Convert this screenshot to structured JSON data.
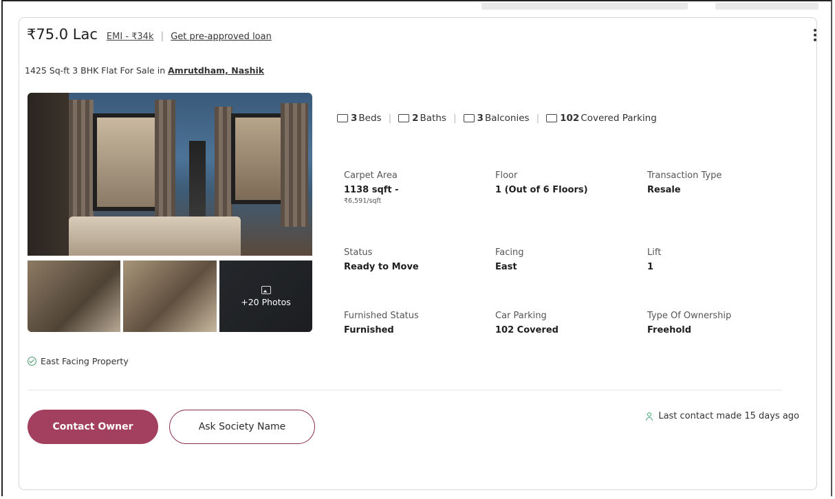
{
  "listing": {
    "price": "₹75.0 Lac",
    "emi": "EMI - ₹34k",
    "separator": "|",
    "loan_link": "Get pre-approved loan",
    "subtitle": "1425 Sq-ft 3 BHK Flat For Sale in",
    "location": "Amrutdham, Nashik"
  },
  "photos": {
    "more_label": "+20 Photos"
  },
  "amenities": [
    {
      "count": "3",
      "label": "Beds",
      "icon": "bed-icon"
    },
    {
      "count": "2",
      "label": "Baths",
      "icon": "bath-icon"
    },
    {
      "count": "3",
      "label": "Balconies",
      "icon": "balcony-icon"
    },
    {
      "count": "102",
      "label": "Covered Parking",
      "icon": "car-icon"
    }
  ],
  "specs": {
    "carpet": {
      "label": "Carpet Area",
      "value": "1138 sqft -",
      "sub": "₹6,591/sqft"
    },
    "floor": {
      "label": "Floor",
      "value": "1 (Out of 6 Floors)"
    },
    "transaction": {
      "label": "Transaction Type",
      "value": "Resale"
    },
    "status": {
      "label": "Status",
      "value": "Ready to Move"
    },
    "facing": {
      "label": "Facing",
      "value": "East"
    },
    "lift": {
      "label": "Lift",
      "value": "1"
    },
    "furnished": {
      "label": "Furnished Status",
      "value": "Furnished"
    },
    "car_parking": {
      "label": "Car Parking",
      "value": "102 Covered"
    },
    "ownership": {
      "label": "Type Of Ownership",
      "value": "Freehold"
    }
  },
  "highlight": "East Facing Property",
  "actions": {
    "contact": "Contact Owner",
    "ask_society": "Ask Society Name",
    "last_contact": "Last contact made 15 days ago"
  },
  "colors": {
    "primary": "#a3405f",
    "check": "#4a9a6a"
  }
}
